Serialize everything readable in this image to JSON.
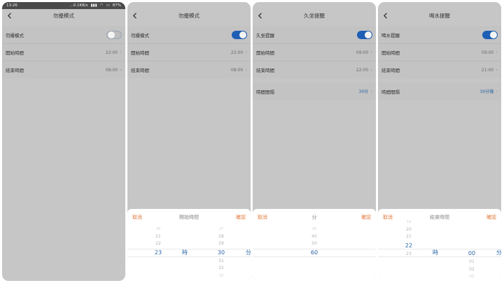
{
  "screens": [
    {
      "status": {
        "time": "13:26",
        "net": "...0.1KB/s",
        "battery": "87%"
      },
      "title": "勿擾模式",
      "rows": [
        {
          "label": "勿擾模式"
        },
        {
          "label": "開始時間",
          "value": "22:00"
        },
        {
          "label": "結束時間",
          "value": "08:00"
        }
      ]
    },
    {
      "title": "勿擾模式",
      "rows": [
        {
          "label": "勿擾模式"
        },
        {
          "label": "開始時間",
          "value": "22:00"
        },
        {
          "label": "結束時間",
          "value": "08:00"
        }
      ],
      "picker": {
        "cancel": "取消",
        "title": "開始時間",
        "confirm": "確認",
        "hours": [
          "20",
          "21",
          "22",
          "23"
        ],
        "hour_selected": "23",
        "hour_unit": "時",
        "minutes": [
          "27",
          "28",
          "29",
          "30",
          "31",
          "32",
          "33"
        ],
        "minute_selected": "30",
        "minute_unit": "分"
      }
    },
    {
      "title": "久坐提醒",
      "rows": [
        {
          "label": "久坐提醒"
        },
        {
          "label": "開始時間",
          "value": "09:00"
        },
        {
          "label": "結束時間",
          "value": "22:00"
        }
      ],
      "rows2": [
        {
          "label": "時間間隔",
          "value": "30分"
        }
      ],
      "picker": {
        "cancel": "取消",
        "title": "分",
        "confirm": "確認",
        "values": [
          "30",
          "40",
          "50",
          "60"
        ],
        "selected": "60"
      }
    },
    {
      "title": "喝水提醒",
      "rows": [
        {
          "label": "喝水提醒"
        },
        {
          "label": "開始時間",
          "value": "09:00"
        },
        {
          "label": "結束時間",
          "value": "21:00"
        }
      ],
      "rows2": [
        {
          "label": "時間間隔",
          "value": "30分鐘"
        }
      ],
      "picker": {
        "cancel": "取消",
        "title": "結束時間",
        "confirm": "確認",
        "hours": [
          "19",
          "20",
          "21",
          "22",
          "23"
        ],
        "hour_selected": "22",
        "hour_unit": "時",
        "minutes": [
          "00",
          "01",
          "02",
          "03"
        ],
        "minute_selected": "00",
        "minute_unit": "分"
      }
    }
  ],
  "colors": {
    "accent": "#1e5fb5",
    "picker_action": "#e2783a",
    "selected_text": "#2b66a6",
    "overlay": "#c6c6c6"
  }
}
